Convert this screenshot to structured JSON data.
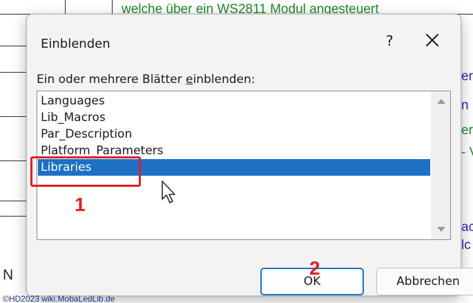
{
  "background": {
    "top_text": "welche über ein WS2811 Modul angesteuert",
    "side_fragments": [
      "er",
      "n",
      "er",
      "- V",
      "ac",
      "lc"
    ],
    "left_letter": "N"
  },
  "dialog": {
    "title": "Einblenden",
    "help_label": "?",
    "close_icon": "close-icon",
    "prompt": {
      "before": "Ein oder mehrere Blätter ",
      "mnemonic": "e",
      "after": "inblenden:"
    },
    "sheets": [
      "Languages",
      "Lib_Macros",
      "Par_Description",
      "Platform_Parameters",
      "Libraries"
    ],
    "selected_sheet": "Libraries",
    "ok_label": "OK",
    "cancel_label": "Abbrechen"
  },
  "annotations": {
    "step1": "1",
    "step2": "2"
  },
  "watermark": "©HD2023 wiki.MobaLedLib.de",
  "colors": {
    "selection": "#1e6fc6",
    "annotation": "#e02020",
    "background_green_text": "#1f8a2e",
    "background_blue_text": "#2a2ab8"
  }
}
